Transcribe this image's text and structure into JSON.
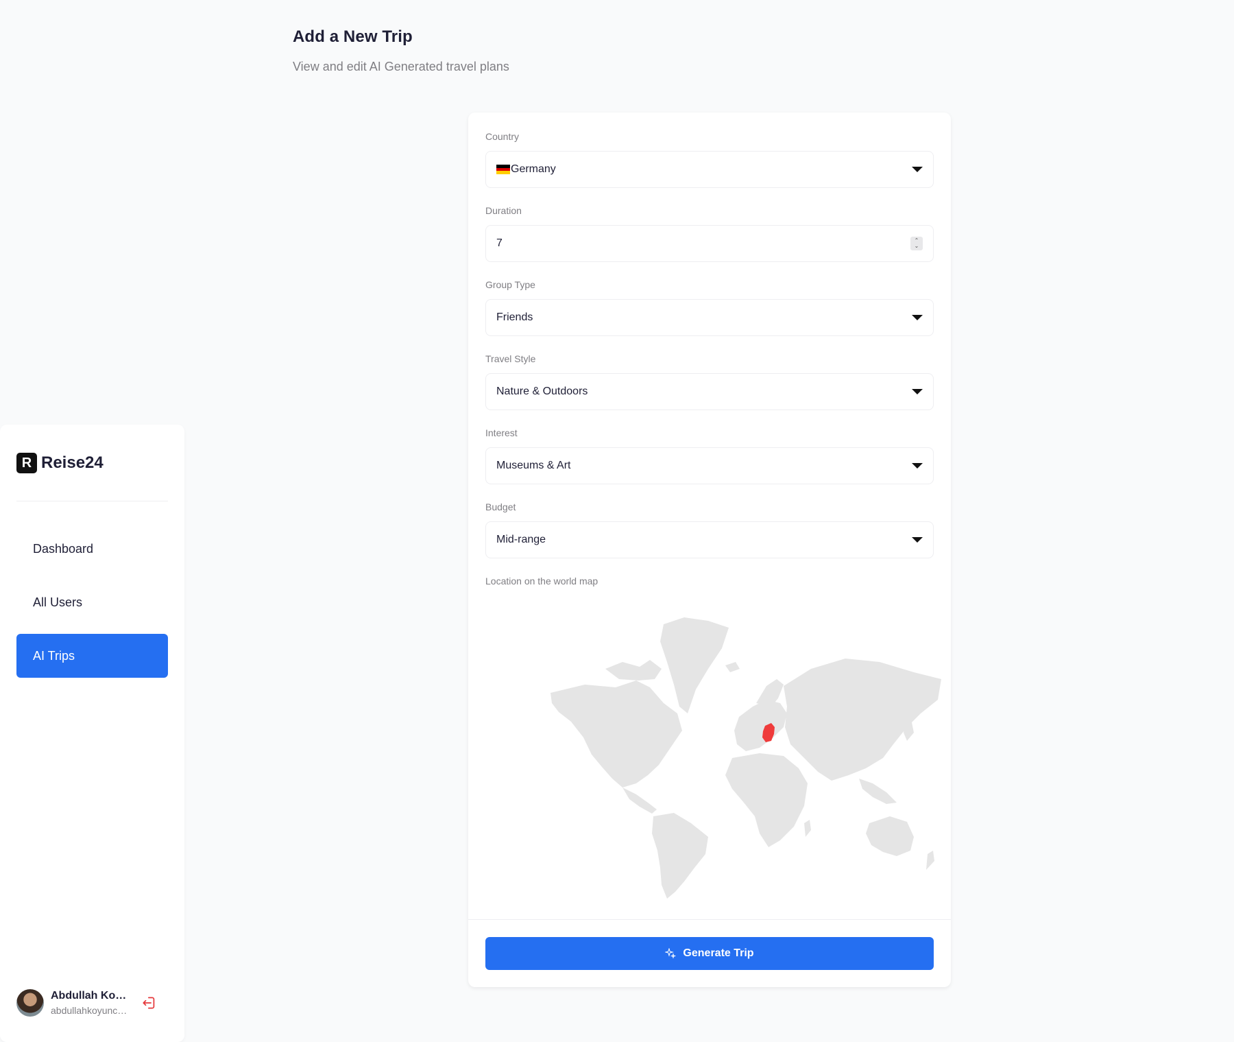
{
  "header": {
    "title": "Add a New Trip",
    "subtitle": "View and edit AI Generated travel plans"
  },
  "form": {
    "country": {
      "label": "Country",
      "value": "Germany",
      "flag_colors": [
        "#000000",
        "#dd0000",
        "#ffce00"
      ]
    },
    "duration": {
      "label": "Duration",
      "value": "7"
    },
    "group_type": {
      "label": "Group Type",
      "value": "Friends"
    },
    "travel_style": {
      "label": "Travel Style",
      "value": "Nature & Outdoors"
    },
    "interest": {
      "label": "Interest",
      "value": "Museums & Art"
    },
    "budget": {
      "label": "Budget",
      "value": "Mid-range"
    },
    "map": {
      "label": "Location on the world map",
      "land_color": "#e5e5e5",
      "highlight_color": "#ef3b3b"
    },
    "submit_label": "Generate Trip"
  },
  "sidebar": {
    "brand": {
      "mark": "R",
      "name": "Reise24"
    },
    "items": [
      {
        "label": "Dashboard",
        "active": false
      },
      {
        "label": "All Users",
        "active": false
      },
      {
        "label": "AI Trips",
        "active": true
      }
    ]
  },
  "user": {
    "name": "Abdullah Koyuncu",
    "email": "abdullahkoyuncu@gmail.com"
  },
  "colors": {
    "accent": "#256ff1",
    "logout": "#e5383b"
  }
}
